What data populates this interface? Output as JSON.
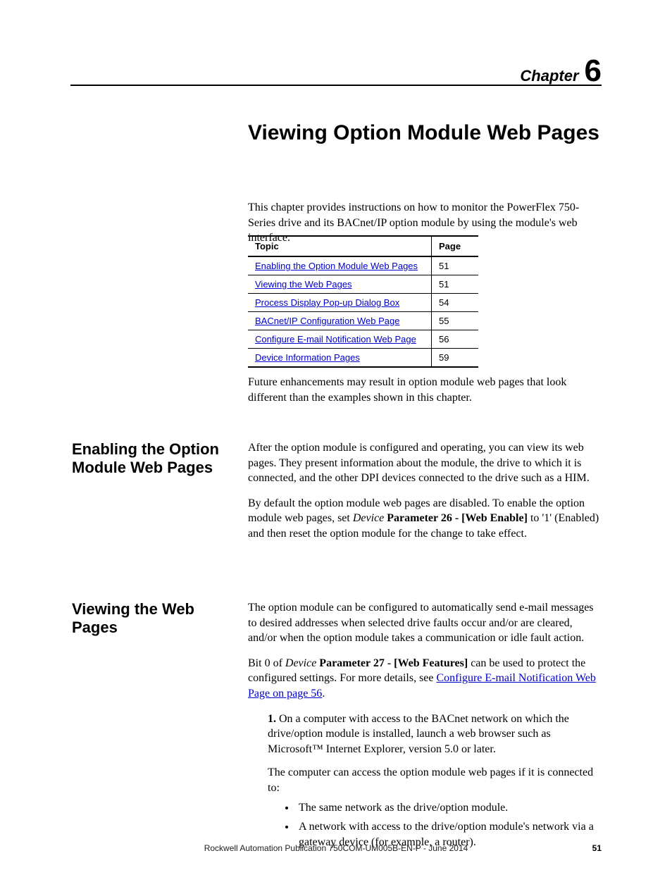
{
  "chapter": {
    "label": "Chapter",
    "number": "6"
  },
  "main_title": "Viewing Option Module Web Pages",
  "intro": "This chapter provides instructions on how to monitor the PowerFlex 750-Series drive and its BACnet/IP option module by using the module's web interface.",
  "toc": {
    "headers": {
      "topic": "Topic",
      "page": "Page"
    },
    "rows": [
      {
        "topic": "Enabling the Option Module Web Pages",
        "page": "51"
      },
      {
        "topic": "Viewing the Web Pages",
        "page": "51"
      },
      {
        "topic": "Process Display Pop-up Dialog Box",
        "page": "54"
      },
      {
        "topic": "BACnet/IP Configuration Web Page",
        "page": "55"
      },
      {
        "topic": "Configure E-mail Notification Web Page",
        "page": "56"
      },
      {
        "topic": "Device Information Pages",
        "page": "59"
      }
    ]
  },
  "below_table": "Future enhancements may result in option module web pages that look different than the examples shown in this chapter.",
  "section1": {
    "heading": "Enabling the Option Module Web Pages",
    "p1": "After the option module is configured and operating, you can view its web pages. They present information about the module, the drive to which it is connected, and the other DPI devices connected to the drive such as a HIM.",
    "p2_a": "By default the option module web pages are disabled. To enable the option module web pages, set ",
    "p2_italic": "Device",
    "p2_bold": " Parameter 26 - [Web Enable]",
    "p2_b": " to '1' (Enabled) and then reset the option module for the change to take effect."
  },
  "section2": {
    "heading": "Viewing the Web Pages",
    "p1": "The option module can be configured to automatically send e-mail messages to desired addresses when selected drive faults occur and/or are cleared, and/or when the option module takes a communication or idle fault action.",
    "p2_a": "Bit 0 of ",
    "p2_italic": "Device",
    "p2_bold": " Parameter 27 - [Web Features]",
    "p2_b": " can be used to protect the configured settings. For more details, see ",
    "p2_link": "Configure E-mail Notification Web Page on page 56",
    "p2_c": ".",
    "step_num": "1.",
    "step_text": "On a computer with access to the BACnet network on which the drive/option module is installed, launch a web browser such as Microsoft™ Internet Explorer, version 5.0 or later.",
    "step_sub": "The computer can access the option module web pages if it is connected to:",
    "bullets": [
      "The same network as the drive/option module.",
      "A network with access to the drive/option module's network via a gateway device (for example, a router)."
    ]
  },
  "footer": {
    "pub": "Rockwell Automation Publication 750COM-UM005B-EN-P - June 2014",
    "page": "51"
  }
}
